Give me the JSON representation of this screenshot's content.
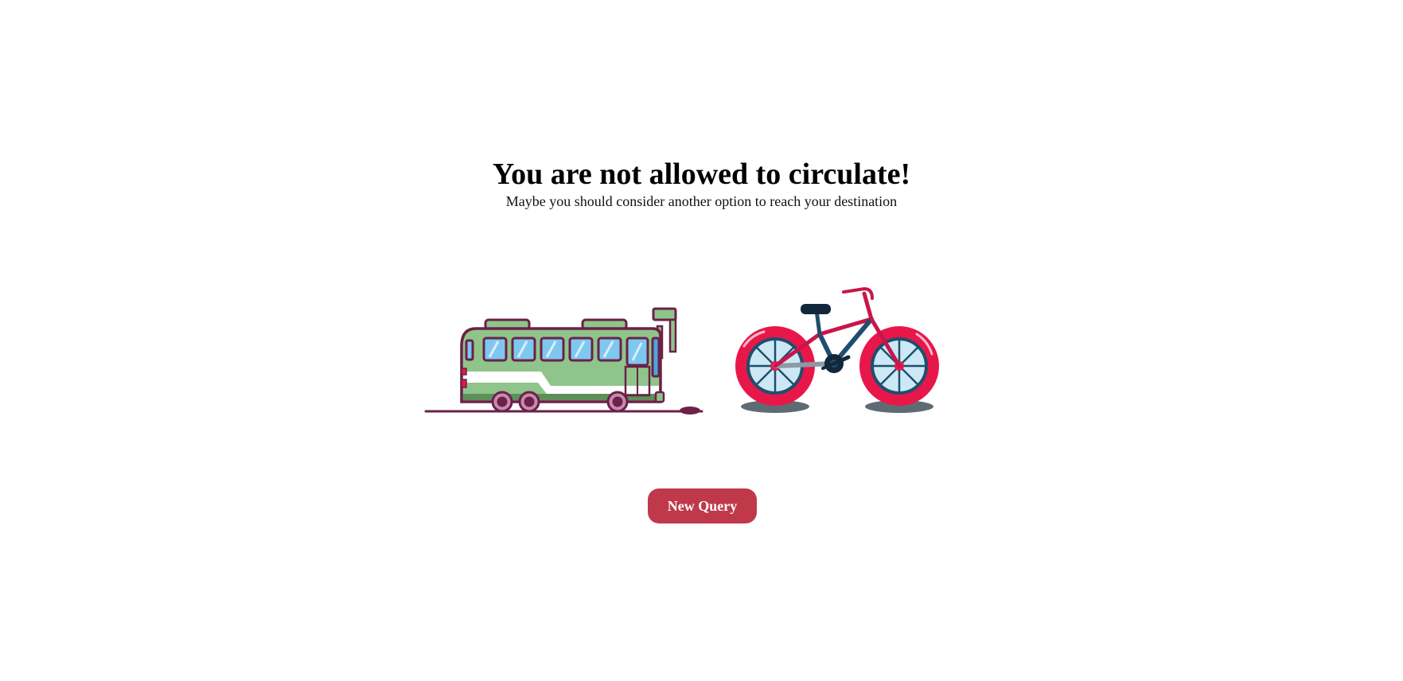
{
  "message": {
    "title": "You are not allowed to circulate!",
    "subtitle": "Maybe you should consider another option to reach your destination"
  },
  "illustration": {
    "items": [
      "bus-icon",
      "bicycle-icon"
    ],
    "colors": {
      "bus_body": "#8fc58a",
      "bus_outline": "#6b2148",
      "bus_window": "#7ec8f0",
      "bike_wheel": "#e8174a",
      "bike_frame_blue": "#1f4e6e",
      "bike_frame_red": "#c8164a",
      "shadow": "#5f6b72"
    }
  },
  "actions": {
    "new_query_label": "New Query"
  },
  "colors": {
    "button": "#c0394b",
    "button_text": "#ffffff",
    "background": "#ffffff"
  }
}
